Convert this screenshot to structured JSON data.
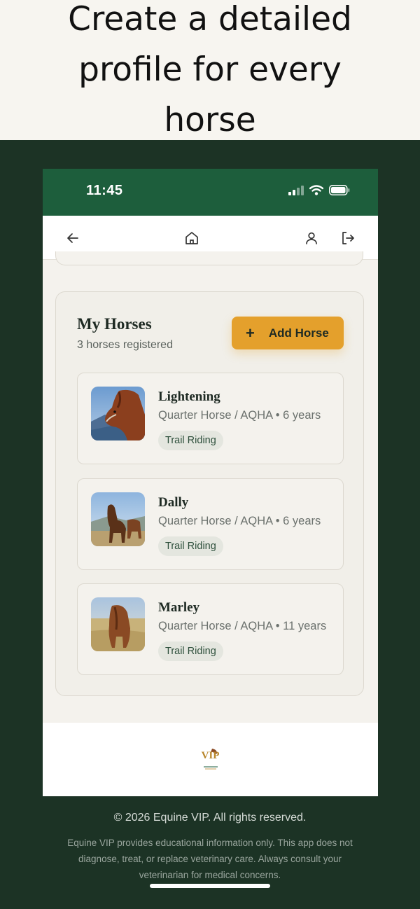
{
  "promo": {
    "headline": "Create a detailed profile for every horse"
  },
  "status_bar": {
    "time": "11:45",
    "icons": [
      "cellular-signal-icon",
      "wifi-icon",
      "battery-icon"
    ]
  },
  "nav": {
    "icons": [
      "back-arrow-icon",
      "home-icon",
      "user-icon",
      "logout-icon"
    ]
  },
  "horses_section": {
    "title": "My Horses",
    "subtitle": "3 horses registered",
    "add_button": {
      "icon": "plus-icon",
      "label": "Add Horse"
    },
    "horses": [
      {
        "name": "Lightening",
        "meta": "Quarter Horse / AQHA • 6 years",
        "tag": "Trail Riding"
      },
      {
        "name": "Dally",
        "meta": "Quarter Horse / AQHA • 6 years",
        "tag": "Trail Riding"
      },
      {
        "name": "Marley",
        "meta": "Quarter Horse / AQHA • 11 years",
        "tag": "Trail Riding"
      }
    ]
  },
  "footer": {
    "logo_text": "VIP",
    "copyright": "© 2026 Equine VIP. All rights reserved.",
    "disclaimer": "Equine VIP provides educational information only. This app does not diagnose, treat, or replace veterinary care. Always consult your veterinarian for medical concerns."
  },
  "colors": {
    "brand_green": "#1d5e3c",
    "dark_background": "#1c3325",
    "accent_gold": "#e4a02c",
    "tag_background": "#e4e6df"
  }
}
